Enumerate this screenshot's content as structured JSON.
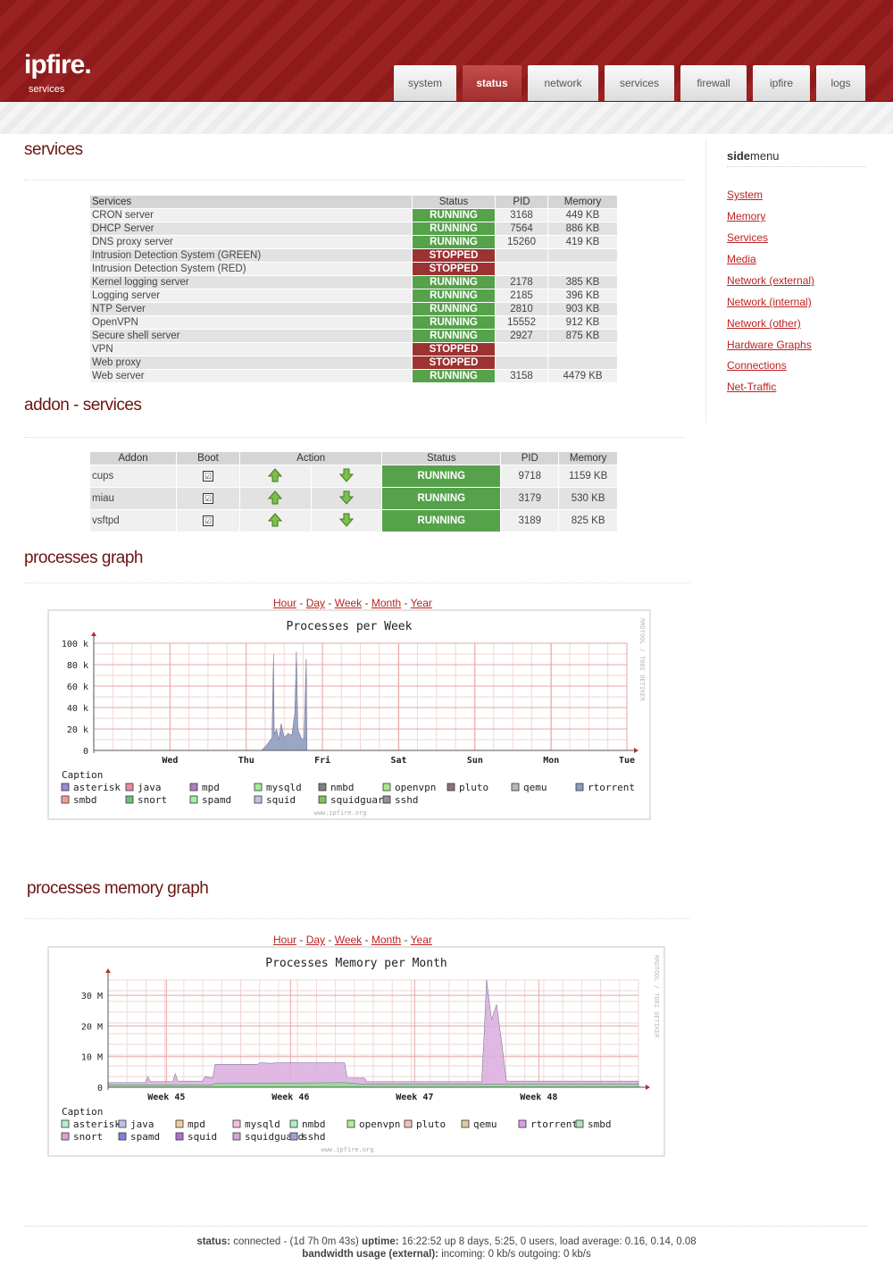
{
  "brand": {
    "name": "ipfire.",
    "subtitle": "services"
  },
  "nav": [
    "system",
    "status",
    "network",
    "services",
    "firewall",
    "ipfire",
    "logs"
  ],
  "nav_active": "status",
  "sections": {
    "services": "services",
    "addon": "addon - services",
    "processes": "processes graph",
    "memory": "processes memory graph"
  },
  "sidemenu": {
    "title_bold": "side",
    "title_rest": "menu",
    "items": [
      "System",
      "Memory",
      "Services",
      "Media",
      "Network (external)",
      "Network (internal)",
      "Network (other)",
      "Hardware Graphs",
      "Connections",
      "Net-Traffic"
    ]
  },
  "services_table": {
    "headers": [
      "Services",
      "Status",
      "PID",
      "Memory"
    ],
    "rows": [
      {
        "name": "CRON server",
        "status": "RUNNING",
        "pid": "3168",
        "memory": "449 KB"
      },
      {
        "name": "DHCP Server",
        "status": "RUNNING",
        "pid": "7564",
        "memory": "886 KB"
      },
      {
        "name": "DNS proxy server",
        "status": "RUNNING",
        "pid": "15260",
        "memory": "419 KB"
      },
      {
        "name": "Intrusion Detection System (GREEN)",
        "status": "STOPPED",
        "pid": "",
        "memory": ""
      },
      {
        "name": "Intrusion Detection System (RED)",
        "status": "STOPPED",
        "pid": "",
        "memory": ""
      },
      {
        "name": "Kernel logging server",
        "status": "RUNNING",
        "pid": "2178",
        "memory": "385 KB"
      },
      {
        "name": "Logging server",
        "status": "RUNNING",
        "pid": "2185",
        "memory": "396 KB"
      },
      {
        "name": "NTP Server",
        "status": "RUNNING",
        "pid": "2810",
        "memory": "903 KB"
      },
      {
        "name": "OpenVPN",
        "status": "RUNNING",
        "pid": "15552",
        "memory": "912 KB"
      },
      {
        "name": "Secure shell server",
        "status": "RUNNING",
        "pid": "2927",
        "memory": "875 KB"
      },
      {
        "name": "VPN",
        "status": "STOPPED",
        "pid": "",
        "memory": ""
      },
      {
        "name": "Web proxy",
        "status": "STOPPED",
        "pid": "",
        "memory": ""
      },
      {
        "name": "Web server",
        "status": "RUNNING",
        "pid": "3158",
        "memory": "4479 KB"
      }
    ]
  },
  "addon_table": {
    "headers": [
      "Addon",
      "Boot",
      "Action",
      "Status",
      "PID",
      "Memory"
    ],
    "rows": [
      {
        "name": "cups",
        "boot": "☑",
        "status": "RUNNING",
        "pid": "9718",
        "memory": "1159 KB"
      },
      {
        "name": "miau",
        "boot": "☑",
        "status": "RUNNING",
        "pid": "3179",
        "memory": "530 KB"
      },
      {
        "name": "vsftpd",
        "boot": "☑",
        "status": "RUNNING",
        "pid": "3189",
        "memory": "825 KB"
      }
    ]
  },
  "graph_links": [
    "Hour",
    "Day",
    "Week",
    "Month",
    "Year"
  ],
  "graph_sep": " - ",
  "colors": {
    "running": "#55a24a",
    "stopped": "#9d3232",
    "brand": "#8e1a1a",
    "link": "#bb2222"
  },
  "chart_data": [
    {
      "type": "area",
      "title": "Processes per Week",
      "x_ticks": [
        "Wed",
        "Thu",
        "Fri",
        "Sat",
        "Sun",
        "Mon",
        "Tue"
      ],
      "y_ticks": [
        "0",
        "20 k",
        "40 k",
        "60 k",
        "80 k",
        "100 k"
      ],
      "ylim": [
        0,
        100000
      ],
      "series": [
        {
          "name": "rtorrent",
          "color": "#8f9cc0",
          "points": [
            [
              2.2,
              0
            ],
            [
              2.27,
              5000
            ],
            [
              2.3,
              8000
            ],
            [
              2.34,
              12000
            ],
            [
              2.36,
              90000
            ],
            [
              2.37,
              15000
            ],
            [
              2.4,
              20000
            ],
            [
              2.43,
              10000
            ],
            [
              2.46,
              25000
            ],
            [
              2.5,
              12000
            ],
            [
              2.55,
              16000
            ],
            [
              2.6,
              14000
            ],
            [
              2.64,
              35000
            ],
            [
              2.66,
              92000
            ],
            [
              2.68,
              20000
            ],
            [
              2.72,
              12000
            ],
            [
              2.76,
              10000
            ],
            [
              2.79,
              85000
            ],
            [
              2.8,
              0
            ]
          ]
        }
      ],
      "legend": [
        "asterisk",
        "java",
        "mpd",
        "mysqld",
        "nmbd",
        "openvpn",
        "pluto",
        "qemu",
        "rtorrent",
        "smbd",
        "snort",
        "spamd",
        "squid",
        "squidguard",
        "sshd"
      ],
      "legend_colors": [
        "#9a88d8",
        "#e88aa0",
        "#b080c0",
        "#9ef090",
        "#808080",
        "#a8e890",
        "#907080",
        "#b8b8b8",
        "#8f9cc0",
        "#f0a090",
        "#70c080",
        "#a0f0a0",
        "#c0c0e0",
        "#80c060",
        "#9090a0"
      ],
      "caption": "Caption",
      "watermark": "www.ipfire.org",
      "side_text": "RRDTOOL / TOBI OETIKER"
    },
    {
      "type": "area",
      "title": "Processes Memory per Month",
      "x_ticks": [
        "Week 45",
        "Week 46",
        "Week 47",
        "Week 48"
      ],
      "y_ticks": [
        "0",
        "10 M",
        "20 M",
        "30 M"
      ],
      "ylim": [
        0,
        35000000
      ],
      "series": [
        {
          "name": "squid",
          "color": "#dcb0e0",
          "points": [
            [
              0,
              1500000
            ],
            [
              0.15,
              1500000
            ],
            [
              0.16,
              3500000
            ],
            [
              0.17,
              1800000
            ],
            [
              0.26,
              1800000
            ],
            [
              0.27,
              4500000
            ],
            [
              0.28,
              2000000
            ],
            [
              0.38,
              2000000
            ],
            [
              0.39,
              3500000
            ],
            [
              0.42,
              3000000
            ],
            [
              0.43,
              7500000
            ],
            [
              0.6,
              7500000
            ],
            [
              0.61,
              8000000
            ],
            [
              0.66,
              7800000
            ],
            [
              0.67,
              8000000
            ],
            [
              0.95,
              8000000
            ],
            [
              0.96,
              3000000
            ],
            [
              1.03,
              3000000
            ],
            [
              1.04,
              1800000
            ],
            [
              1.5,
              1800000
            ],
            [
              1.51,
              17000000
            ],
            [
              1.52,
              35000000
            ],
            [
              1.54,
              22000000
            ],
            [
              1.56,
              27000000
            ],
            [
              1.58,
              15000000
            ],
            [
              1.6,
              2000000
            ],
            [
              2.13,
              2000000
            ]
          ]
        },
        {
          "name": "openvpn",
          "color": "#90e090",
          "points": [
            [
              0,
              800000
            ],
            [
              0.42,
              800000
            ],
            [
              0.43,
              1200000
            ],
            [
              0.95,
              1500000
            ],
            [
              1.03,
              1000000
            ],
            [
              2.13,
              1000000
            ]
          ]
        }
      ],
      "legend": [
        "asterisk",
        "java",
        "mpd",
        "mysqld",
        "nmbd",
        "openvpn",
        "pluto",
        "qemu",
        "rtorrent",
        "smbd",
        "snort",
        "spamd",
        "squid",
        "squidguard",
        "sshd"
      ],
      "legend_colors": [
        "#b0f0d0",
        "#c0c0f0",
        "#f0d0a0",
        "#f0c0e0",
        "#b0f0c0",
        "#b0f090",
        "#f0c0c0",
        "#e0c8a0",
        "#d8a0e8",
        "#b0e0c0",
        "#e0a0d0",
        "#8080e0",
        "#b070d0",
        "#d8a0e0",
        "#a0a0d0"
      ],
      "caption": "Caption",
      "watermark": "www.ipfire.org",
      "side_text": "RRDTOOL / TOBI OETIKER"
    }
  ],
  "footer": {
    "status_label": "status:",
    "status_text": " connected - (1d 7h 0m 43s) ",
    "uptime_label": "uptime:",
    "uptime_text": " 16:22:52 up 8 days, 5:25, 0 users, load average: 0.16, 0.14, 0.08",
    "bw_label": "bandwidth usage (external):",
    "bw_text": " incoming: 0 kb/s outgoing: 0 kb/s"
  }
}
